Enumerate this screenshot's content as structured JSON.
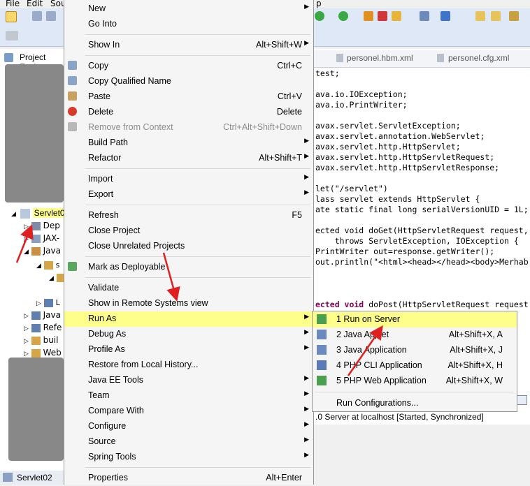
{
  "menubar": {
    "file": "File",
    "edit": "Edit",
    "source_partial": "Sou",
    "help_partial": "p"
  },
  "explorer": {
    "tab_label": "Project Expl",
    "project": "Servlet02",
    "items": [
      "Dep",
      "JAX-",
      "Java",
      "Java",
      "Refe",
      "buil",
      "Web"
    ],
    "status_project": "Servlet02"
  },
  "editor": {
    "tabs": [
      "personel.hbm.xml",
      "personel.cfg.xml"
    ],
    "lines": [
      "test;",
      "",
      "ava.io.IOException;",
      "ava.io.PrintWriter;",
      "",
      "avax.servlet.ServletException;",
      "avax.servlet.annotation.WebServlet;",
      "avax.servlet.http.HttpServlet;",
      "avax.servlet.http.HttpServletRequest;",
      "avax.servlet.http.HttpServletResponse;",
      "",
      "let(\"/servlet\")",
      "lass servlet extends HttpServlet {",
      "ate static final long serialVersionUID = 1L;",
      "",
      "ected void doGet(HttpServletRequest request,",
      "    throws ServletException, IOException {",
      "PrintWriter out=response.getWriter();",
      "out.println(\"<html><head></head><body>Merhab"
    ],
    "line_bottom": "ected void doPost(HttpServletRequest request",
    "server_status": ".0 Server at localhost  [Started, Synchronized]"
  },
  "context_menu": [
    {
      "label": "New",
      "shortcut": "",
      "arrow": true
    },
    {
      "label": "Go Into",
      "shortcut": ""
    },
    {
      "sep": true
    },
    {
      "label": "Show In",
      "shortcut": "Alt+Shift+W",
      "arrow": true
    },
    {
      "sep": true
    },
    {
      "label": "Copy",
      "shortcut": "Ctrl+C",
      "icon": "copy-icon"
    },
    {
      "label": "Copy Qualified Name",
      "shortcut": "",
      "icon": "copy-qualified-icon"
    },
    {
      "label": "Paste",
      "shortcut": "Ctrl+V",
      "icon": "paste-icon"
    },
    {
      "label": "Delete",
      "shortcut": "Delete",
      "icon": "delete-icon"
    },
    {
      "label": "Remove from Context",
      "shortcut": "Ctrl+Alt+Shift+Down",
      "disabled": true,
      "icon": "remove-context-icon"
    },
    {
      "label": "Build Path",
      "shortcut": "",
      "arrow": true
    },
    {
      "label": "Refactor",
      "shortcut": "Alt+Shift+T",
      "arrow": true
    },
    {
      "sep": true
    },
    {
      "label": "Import",
      "shortcut": "",
      "arrow": true
    },
    {
      "label": "Export",
      "shortcut": "",
      "arrow": true
    },
    {
      "sep": true
    },
    {
      "label": "Refresh",
      "shortcut": "F5"
    },
    {
      "label": "Close Project",
      "shortcut": ""
    },
    {
      "label": "Close Unrelated Projects",
      "shortcut": ""
    },
    {
      "sep": true
    },
    {
      "label": "Mark as Deployable",
      "shortcut": "",
      "icon": "deployable-icon"
    },
    {
      "sep": true
    },
    {
      "label": "Validate",
      "shortcut": ""
    },
    {
      "label": "Show in Remote Systems view",
      "shortcut": ""
    },
    {
      "label": "Run As",
      "shortcut": "",
      "arrow": true,
      "highlight": true
    },
    {
      "label": "Debug As",
      "shortcut": "",
      "arrow": true
    },
    {
      "label": "Profile As",
      "shortcut": "",
      "arrow": true
    },
    {
      "label": "Restore from Local History...",
      "shortcut": ""
    },
    {
      "label": "Java EE Tools",
      "shortcut": "",
      "arrow": true
    },
    {
      "label": "Team",
      "shortcut": "",
      "arrow": true
    },
    {
      "label": "Compare With",
      "shortcut": "",
      "arrow": true
    },
    {
      "label": "Configure",
      "shortcut": "",
      "arrow": true
    },
    {
      "label": "Source",
      "shortcut": "",
      "arrow": true
    },
    {
      "label": "Spring Tools",
      "shortcut": "",
      "arrow": true
    },
    {
      "sep": true
    },
    {
      "label": "Properties",
      "shortcut": "Alt+Enter"
    }
  ],
  "run_as_submenu": [
    {
      "label": "1 Run on Server",
      "shortcut": "",
      "highlight": true,
      "icon": "run-server-icon"
    },
    {
      "label": "2 Java Applet",
      "shortcut": "Alt+Shift+X, A",
      "icon": "java-applet-icon"
    },
    {
      "label": "3 Java Application",
      "shortcut": "Alt+Shift+X, J",
      "icon": "java-app-icon"
    },
    {
      "label": "4 PHP CLI Application",
      "shortcut": "Alt+Shift+X, H",
      "icon": "php-cli-icon"
    },
    {
      "label": "5 PHP Web Application",
      "shortcut": "Alt+Shift+X, W",
      "icon": "php-web-icon"
    },
    {
      "sep": true
    },
    {
      "label": "Run Configurations...",
      "shortcut": ""
    }
  ],
  "colors": {
    "highlight": "#ffff78",
    "arrow": "#e02020",
    "menu_bg": "#f5f5f5"
  }
}
